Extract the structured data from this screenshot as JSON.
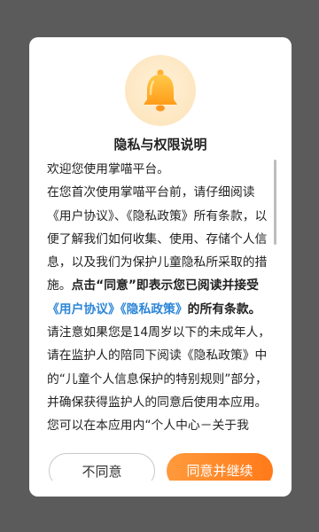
{
  "dialog": {
    "title": "隐私与权限说明",
    "welcome": "欢迎您使用掌喵平台。",
    "para1_start": " 在您首次使用掌喵平台前，请仔细阅读《用户协议》、《隐私政策》所有条款，以便了解我们如何收集、使用、存储个人信息，以及我们为保护儿童隐私所采取的措施。",
    "para1_bold": "点击“同意”即表示您已阅读并接受",
    "link_user_agreement": "《用户协议》",
    "link_privacy_policy": "《隐私政策》",
    "para1_end": "的所有条款。",
    "para2": "请注意如果您是14周岁以下的未成年人，请在监护人的陪同下阅读《隐私政策》中的“儿童个人信息保护的特别规则”部分，并确保获得监护人的同意后使用本应用。",
    "para3": "您可以在本应用内“个人中心－关于我",
    "disagree_label": "不同意",
    "agree_label": "同意并继续",
    "bell_icon": "bell-icon",
    "accent_color": "#ff8a2a",
    "link_color": "#2c86d8"
  }
}
